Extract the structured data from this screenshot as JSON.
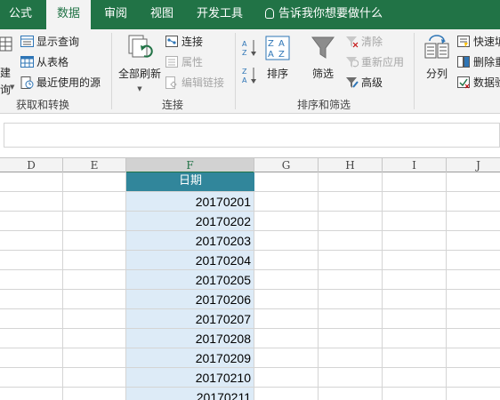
{
  "tabs": [
    "公式",
    "数据",
    "审阅",
    "视图",
    "开发工具"
  ],
  "active_tab": "数据",
  "tell_me": "告诉我你想要做什么",
  "ribbon": {
    "get_transform": {
      "new_query_partial_1": "建",
      "new_query_partial_2": "询",
      "show_queries": "显示查询",
      "from_table": "从表格",
      "recent_sources": "最近使用的源",
      "group_label": "获取和转换"
    },
    "connections": {
      "refresh_all": "全部刷新",
      "connections": "连接",
      "properties": "属性",
      "edit_links": "编辑链接",
      "group_label": "连接"
    },
    "sort_filter": {
      "sort": "排序",
      "filter": "筛选",
      "clear": "清除",
      "reapply": "重新应用",
      "advanced": "高级",
      "group_label": "排序和筛选"
    },
    "data_tools": {
      "split": "分列",
      "flash_fill": "快速填",
      "remove_dup": "删除重",
      "validation": "数据验"
    }
  },
  "formula_bar": {
    "value": ""
  },
  "columns": [
    "D",
    "E",
    "F",
    "G",
    "H",
    "I",
    "J"
  ],
  "selected_column": "F",
  "sheet": {
    "header": "日期",
    "rows": [
      "20170201",
      "20170202",
      "20170203",
      "20170204",
      "20170205",
      "20170206",
      "20170207",
      "20170208",
      "20170209",
      "20170210",
      "20170211"
    ]
  },
  "colors": {
    "excel_green": "#217346",
    "header_fill": "#31869b",
    "column_fill": "#ddebf7"
  }
}
